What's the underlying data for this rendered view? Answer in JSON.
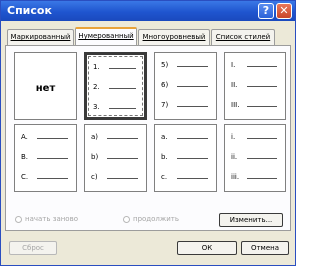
{
  "window": {
    "title": "Список",
    "help_glyph": "?",
    "close_glyph": "✕"
  },
  "tabs": [
    {
      "label": "Маркированный"
    },
    {
      "label": "Нумерованный"
    },
    {
      "label": "Многоуровневый"
    },
    {
      "label": "Список стилей"
    }
  ],
  "active_tab_index": 1,
  "grid": {
    "none_label": "нет",
    "cells": [
      {
        "markers": []
      },
      {
        "markers": [
          "1.",
          "2.",
          "3."
        ]
      },
      {
        "markers": [
          "5)",
          "6)",
          "7)"
        ]
      },
      {
        "markers": [
          "I.",
          "II.",
          "III."
        ]
      },
      {
        "markers": [
          "A.",
          "B.",
          "C."
        ]
      },
      {
        "markers": [
          "a)",
          "b)",
          "c)"
        ]
      },
      {
        "markers": [
          "a.",
          "b.",
          "c."
        ]
      },
      {
        "markers": [
          "i.",
          "ii.",
          "iii."
        ]
      }
    ]
  },
  "options": {
    "restart_label": "начать заново",
    "continue_label": "продолжить"
  },
  "buttons": {
    "change": "Изменить...",
    "reset": "Сброс",
    "ok": "ОК",
    "cancel": "Отмена"
  }
}
